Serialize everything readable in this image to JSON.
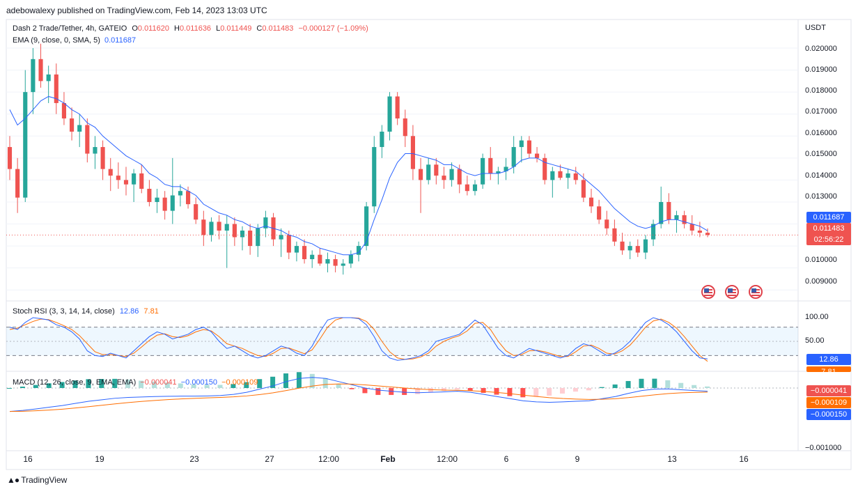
{
  "header": {
    "published": "adebowalexy published on TradingView.com, Feb 14, 2023 13:03 UTC"
  },
  "symbol": {
    "name": "Dash 2 Trade/Tether, 4h, GATEIO",
    "open_label": "O",
    "open": "0.011620",
    "high_label": "H",
    "high": "0.011636",
    "low_label": "L",
    "low": "0.011449",
    "close_label": "C",
    "close": "0.011483",
    "change": "−0.000127 (−1.09%)"
  },
  "ema": {
    "label": "EMA (9, close, 0, SMA, 5)",
    "value": "0.011687"
  },
  "stoch": {
    "label": "Stoch RSI (3, 3, 14, 14, close)",
    "k": "12.86",
    "d": "7.81"
  },
  "macd": {
    "label": "MACD (12, 26, close, 9, EMA, EMA)",
    "hist": "−0.000041",
    "macd": "−0.000150",
    "signal": "−0.000109"
  },
  "price_axis": {
    "currency": "USDT",
    "ticks": [
      "0.020000",
      "0.019000",
      "0.018000",
      "0.017000",
      "0.016000",
      "0.015000",
      "0.014000",
      "0.013000",
      "0.009000"
    ],
    "ticks_lower": [
      "0.010000"
    ],
    "ema_badge": "0.011687",
    "close_badge": "0.011483",
    "countdown": "02:56:22"
  },
  "stoch_axis": {
    "ticks": [
      "100.00",
      "50.00"
    ],
    "badge": "12.86",
    "badge2": "7.81"
  },
  "macd_axis": {
    "badges": [
      "−0.000041",
      "−0.000109",
      "−0.000150"
    ],
    "tick": "−0.001000"
  },
  "time_axis": {
    "labels": [
      "16",
      "19",
      "23",
      "27",
      "12:00",
      "Feb",
      "12:00",
      "6",
      "9",
      "13",
      "16"
    ]
  },
  "footer": {
    "brand": "TradingView"
  },
  "colors": {
    "up": "#26a69a",
    "down": "#ef5350",
    "ema": "#2962ff",
    "stoch_k": "#2962ff",
    "stoch_d": "#ff6d00",
    "macd": "#2962ff",
    "signal": "#ff6d00"
  },
  "chart_data": {
    "type": "candlestick",
    "price_range": [
      0.0085,
      0.0213
    ],
    "candles": [
      [
        0.0155,
        0.016,
        0.014,
        0.0145
      ],
      [
        0.0145,
        0.015,
        0.0125,
        0.0132
      ],
      [
        0.0132,
        0.019,
        0.013,
        0.018
      ],
      [
        0.018,
        0.02,
        0.017,
        0.0195
      ],
      [
        0.0195,
        0.0202,
        0.0182,
        0.0185
      ],
      [
        0.0185,
        0.0192,
        0.0175,
        0.0188
      ],
      [
        0.0188,
        0.0193,
        0.017,
        0.0175
      ],
      [
        0.0175,
        0.018,
        0.0165,
        0.0168
      ],
      [
        0.0168,
        0.0173,
        0.0158,
        0.0162
      ],
      [
        0.0162,
        0.017,
        0.0155,
        0.0165
      ],
      [
        0.0165,
        0.0168,
        0.0148,
        0.0152
      ],
      [
        0.0152,
        0.016,
        0.0145,
        0.0155
      ],
      [
        0.0155,
        0.0158,
        0.014,
        0.0145
      ],
      [
        0.0145,
        0.015,
        0.0135,
        0.0142
      ],
      [
        0.0142,
        0.0148,
        0.0136,
        0.014
      ],
      [
        0.014,
        0.0146,
        0.0133,
        0.0138
      ],
      [
        0.0138,
        0.0145,
        0.013,
        0.0143
      ],
      [
        0.0143,
        0.0147,
        0.0134,
        0.0136
      ],
      [
        0.0136,
        0.014,
        0.0128,
        0.013
      ],
      [
        0.013,
        0.0136,
        0.0125,
        0.0132
      ],
      [
        0.0132,
        0.0135,
        0.0122,
        0.0126
      ],
      [
        0.0126,
        0.015,
        0.012,
        0.0133
      ],
      [
        0.0133,
        0.0138,
        0.0128,
        0.0135
      ],
      [
        0.0135,
        0.0137,
        0.0127,
        0.0129
      ],
      [
        0.0129,
        0.0132,
        0.012,
        0.0122
      ],
      [
        0.0122,
        0.0126,
        0.011,
        0.0115
      ],
      [
        0.0115,
        0.0123,
        0.0112,
        0.0121
      ],
      [
        0.0121,
        0.0124,
        0.0113,
        0.0117
      ],
      [
        0.0117,
        0.0124,
        0.01,
        0.012
      ],
      [
        0.012,
        0.0123,
        0.011,
        0.0114
      ],
      [
        0.0114,
        0.0119,
        0.0108,
        0.0117
      ],
      [
        0.0117,
        0.012,
        0.0106,
        0.011
      ],
      [
        0.011,
        0.012,
        0.0105,
        0.0118
      ],
      [
        0.0118,
        0.0126,
        0.0114,
        0.0123
      ],
      [
        0.0123,
        0.0125,
        0.011,
        0.0113
      ],
      [
        0.0113,
        0.0118,
        0.0105,
        0.0115
      ],
      [
        0.0115,
        0.0117,
        0.0104,
        0.0107
      ],
      [
        0.0107,
        0.0112,
        0.0103,
        0.011
      ],
      [
        0.011,
        0.0113,
        0.0102,
        0.0104
      ],
      [
        0.0104,
        0.0108,
        0.01,
        0.0106
      ],
      [
        0.0106,
        0.0109,
        0.0101,
        0.0102
      ],
      [
        0.0102,
        0.0107,
        0.0098,
        0.0104
      ],
      [
        0.0104,
        0.0106,
        0.0098,
        0.0101
      ],
      [
        0.0101,
        0.0104,
        0.0097,
        0.0102
      ],
      [
        0.0102,
        0.0108,
        0.01,
        0.0106
      ],
      [
        0.0106,
        0.0112,
        0.0103,
        0.011
      ],
      [
        0.011,
        0.013,
        0.0108,
        0.0128
      ],
      [
        0.0128,
        0.016,
        0.0125,
        0.0155
      ],
      [
        0.0155,
        0.0165,
        0.015,
        0.0162
      ],
      [
        0.0162,
        0.018,
        0.0158,
        0.0178
      ],
      [
        0.0178,
        0.018,
        0.0165,
        0.0168
      ],
      [
        0.0168,
        0.0172,
        0.0155,
        0.016
      ],
      [
        0.016,
        0.0165,
        0.014,
        0.0145
      ],
      [
        0.0145,
        0.015,
        0.0125,
        0.014
      ],
      [
        0.014,
        0.015,
        0.0138,
        0.0147
      ],
      [
        0.0147,
        0.015,
        0.0138,
        0.0142
      ],
      [
        0.0142,
        0.0146,
        0.0136,
        0.014
      ],
      [
        0.014,
        0.0148,
        0.0137,
        0.0145
      ],
      [
        0.0145,
        0.0147,
        0.0134,
        0.0138
      ],
      [
        0.0138,
        0.0142,
        0.0133,
        0.0135
      ],
      [
        0.0135,
        0.014,
        0.0133,
        0.0138
      ],
      [
        0.0138,
        0.0152,
        0.0136,
        0.015
      ],
      [
        0.015,
        0.0155,
        0.014,
        0.0143
      ],
      [
        0.0143,
        0.0146,
        0.0138,
        0.0144
      ],
      [
        0.0144,
        0.015,
        0.014,
        0.0146
      ],
      [
        0.0146,
        0.016,
        0.0143,
        0.0155
      ],
      [
        0.0155,
        0.016,
        0.0148,
        0.0158
      ],
      [
        0.0158,
        0.016,
        0.015,
        0.0152
      ],
      [
        0.0152,
        0.0155,
        0.0148,
        0.015
      ],
      [
        0.015,
        0.0152,
        0.0138,
        0.014
      ],
      [
        0.014,
        0.0146,
        0.0132,
        0.0144
      ],
      [
        0.0144,
        0.0147,
        0.014,
        0.0141
      ],
      [
        0.0141,
        0.0145,
        0.0136,
        0.0143
      ],
      [
        0.0143,
        0.0146,
        0.0138,
        0.014
      ],
      [
        0.014,
        0.0143,
        0.013,
        0.0132
      ],
      [
        0.0132,
        0.0136,
        0.0125,
        0.0128
      ],
      [
        0.0128,
        0.0131,
        0.012,
        0.0122
      ],
      [
        0.0122,
        0.0126,
        0.0115,
        0.0118
      ],
      [
        0.0118,
        0.0122,
        0.011,
        0.0112
      ],
      [
        0.0112,
        0.0116,
        0.0106,
        0.0108
      ],
      [
        0.0108,
        0.0112,
        0.0104,
        0.011
      ],
      [
        0.011,
        0.0113,
        0.0105,
        0.0107
      ],
      [
        0.0107,
        0.0115,
        0.0104,
        0.0113
      ],
      [
        0.0113,
        0.0122,
        0.011,
        0.012
      ],
      [
        0.012,
        0.0137,
        0.0118,
        0.013
      ],
      [
        0.013,
        0.0134,
        0.012,
        0.0122
      ],
      [
        0.0122,
        0.0126,
        0.0116,
        0.0124
      ],
      [
        0.0124,
        0.0126,
        0.0118,
        0.012
      ],
      [
        0.012,
        0.0124,
        0.0115,
        0.0117
      ],
      [
        0.0117,
        0.0121,
        0.0114,
        0.0116
      ],
      [
        0.0116,
        0.0118,
        0.0114,
        0.0115
      ]
    ],
    "ema": [
      0.0172,
      0.0165,
      0.0168,
      0.0172,
      0.0176,
      0.0178,
      0.0177,
      0.0175,
      0.0172,
      0.017,
      0.0166,
      0.0164,
      0.016,
      0.0157,
      0.0154,
      0.0151,
      0.0149,
      0.0147,
      0.0143,
      0.0141,
      0.0138,
      0.0137,
      0.0137,
      0.0135,
      0.0133,
      0.0129,
      0.0127,
      0.0125,
      0.0124,
      0.0122,
      0.0121,
      0.0119,
      0.0118,
      0.0119,
      0.0118,
      0.0117,
      0.0115,
      0.0114,
      0.0112,
      0.0111,
      0.0109,
      0.0108,
      0.0107,
      0.0106,
      0.0106,
      0.0107,
      0.0112,
      0.0122,
      0.0131,
      0.0141,
      0.0148,
      0.0152,
      0.0152,
      0.0151,
      0.015,
      0.0149,
      0.0147,
      0.0147,
      0.0145,
      0.0143,
      0.0142,
      0.0143,
      0.0143,
      0.0143,
      0.0144,
      0.0146,
      0.0149,
      0.015,
      0.015,
      0.0148,
      0.0147,
      0.0146,
      0.0145,
      0.0144,
      0.0141,
      0.0138,
      0.0135,
      0.0131,
      0.0127,
      0.0124,
      0.0121,
      0.0119,
      0.0118,
      0.0119,
      0.0121,
      0.0122,
      0.0122,
      0.0121,
      0.012,
      0.0119,
      0.01169
    ],
    "stoch_k": [
      80,
      75,
      90,
      100,
      98,
      95,
      85,
      80,
      70,
      55,
      30,
      20,
      18,
      25,
      20,
      15,
      30,
      45,
      60,
      70,
      65,
      55,
      60,
      65,
      75,
      80,
      70,
      50,
      35,
      40,
      30,
      20,
      15,
      20,
      30,
      40,
      35,
      25,
      20,
      40,
      70,
      95,
      100,
      100,
      100,
      98,
      85,
      60,
      30,
      15,
      10,
      12,
      15,
      20,
      30,
      50,
      55,
      60,
      65,
      80,
      95,
      85,
      60,
      35,
      20,
      15,
      25,
      35,
      30,
      25,
      20,
      15,
      20,
      35,
      45,
      40,
      30,
      20,
      25,
      35,
      50,
      70,
      90,
      100,
      95,
      85,
      70,
      50,
      30,
      15,
      12.86
    ],
    "stoch_d": [
      75,
      78,
      85,
      92,
      97,
      96,
      90,
      83,
      75,
      62,
      45,
      28,
      22,
      22,
      20,
      18,
      25,
      38,
      52,
      63,
      66,
      60,
      58,
      62,
      70,
      75,
      72,
      60,
      45,
      40,
      35,
      27,
      20,
      18,
      25,
      35,
      36,
      30,
      24,
      32,
      55,
      80,
      95,
      100,
      100,
      99,
      92,
      75,
      50,
      28,
      15,
      12,
      13,
      17,
      25,
      40,
      50,
      57,
      62,
      72,
      88,
      90,
      75,
      50,
      30,
      20,
      22,
      30,
      31,
      28,
      23,
      18,
      18,
      28,
      40,
      42,
      35,
      25,
      23,
      30,
      42,
      60,
      80,
      93,
      97,
      90,
      78,
      60,
      40,
      20,
      7.81
    ],
    "macd": [
      -0.0011,
      -0.00105,
      -0.00098,
      -0.0009,
      -0.00082,
      -0.00072,
      -0.00062,
      -0.00055,
      -0.00048,
      -0.00044,
      -0.00042,
      -0.0004,
      -0.00039,
      -0.00038,
      -0.00038,
      -0.00037,
      -0.00035,
      -0.0003,
      -0.0002,
      -5e-05,
      0.0001,
      0.0003,
      0.00045,
      0.0005,
      0.00045,
      0.0003,
      0.00015,
      0.0,
      -0.0001,
      -0.00015,
      -0.0002,
      -0.00022,
      -0.0002,
      -0.00018,
      -0.00015,
      -0.0002,
      -0.0003,
      -0.0004,
      -0.0005,
      -0.0006,
      -0.00065,
      -0.00067,
      -0.00065,
      -0.00062,
      -0.0006,
      -0.0005,
      -0.0004,
      -0.00025,
      -0.00012,
      -5e-05,
      -4e-05,
      -8e-05,
      -0.00012,
      -0.00015
    ]
  }
}
